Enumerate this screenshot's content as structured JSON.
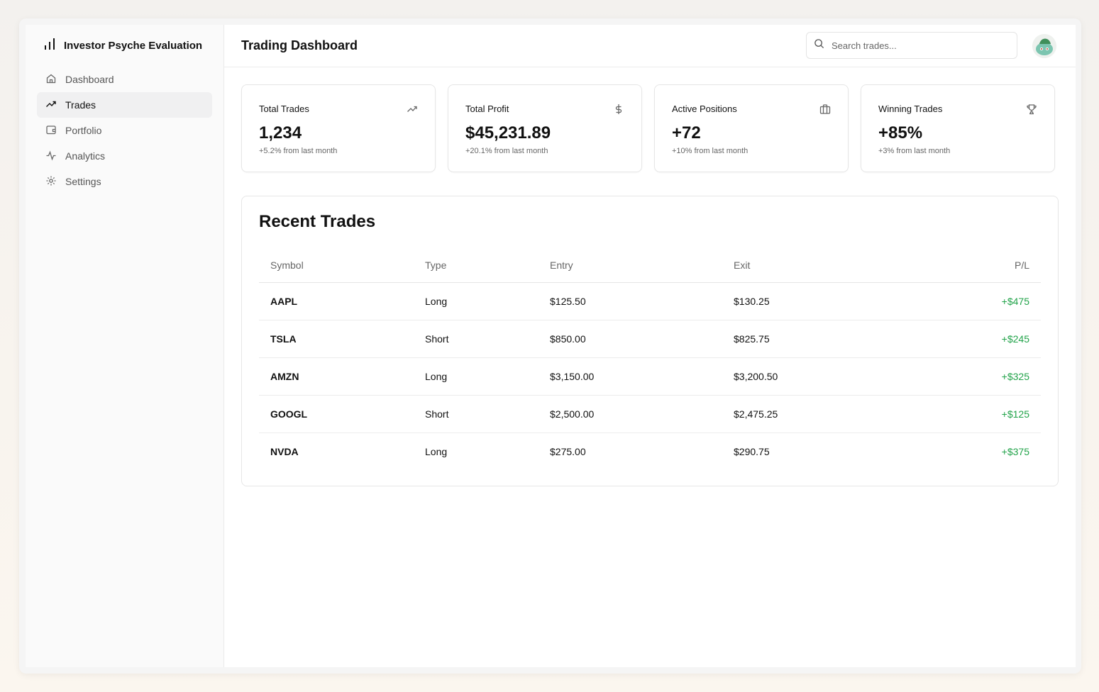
{
  "app": {
    "title": "Investor Psyche Evaluation"
  },
  "sidebar": {
    "items": [
      {
        "label": "Dashboard",
        "icon": "home-icon"
      },
      {
        "label": "Trades",
        "icon": "trending-up-icon",
        "active": true
      },
      {
        "label": "Portfolio",
        "icon": "wallet-icon"
      },
      {
        "label": "Analytics",
        "icon": "activity-icon"
      },
      {
        "label": "Settings",
        "icon": "gear-icon"
      }
    ]
  },
  "header": {
    "title": "Trading Dashboard",
    "search_placeholder": "Search trades..."
  },
  "stats": [
    {
      "title": "Total Trades",
      "value": "1,234",
      "sub": "+5.2% from last month",
      "icon": "trending-up-icon"
    },
    {
      "title": "Total Profit",
      "value": "$45,231.89",
      "sub": "+20.1% from last month",
      "icon": "dollar-icon"
    },
    {
      "title": "Active Positions",
      "value": "+72",
      "sub": "+10% from last month",
      "icon": "briefcase-icon"
    },
    {
      "title": "Winning Trades",
      "value": "+85%",
      "sub": "+3% from last month",
      "icon": "trophy-icon"
    }
  ],
  "recent": {
    "title": "Recent Trades",
    "columns": [
      "Symbol",
      "Type",
      "Entry",
      "Exit",
      "P/L"
    ],
    "rows": [
      [
        "AAPL",
        "Long",
        "$125.50",
        "$130.25",
        "+$475"
      ],
      [
        "TSLA",
        "Short",
        "$850.00",
        "$825.75",
        "+$245"
      ],
      [
        "AMZN",
        "Long",
        "$3,150.00",
        "$3,200.50",
        "+$325"
      ],
      [
        "GOOGL",
        "Short",
        "$2,500.00",
        "$2,475.25",
        "+$125"
      ],
      [
        "NVDA",
        "Long",
        "$275.00",
        "$290.75",
        "+$375"
      ]
    ]
  },
  "colors": {
    "profit": "#22a34a"
  }
}
